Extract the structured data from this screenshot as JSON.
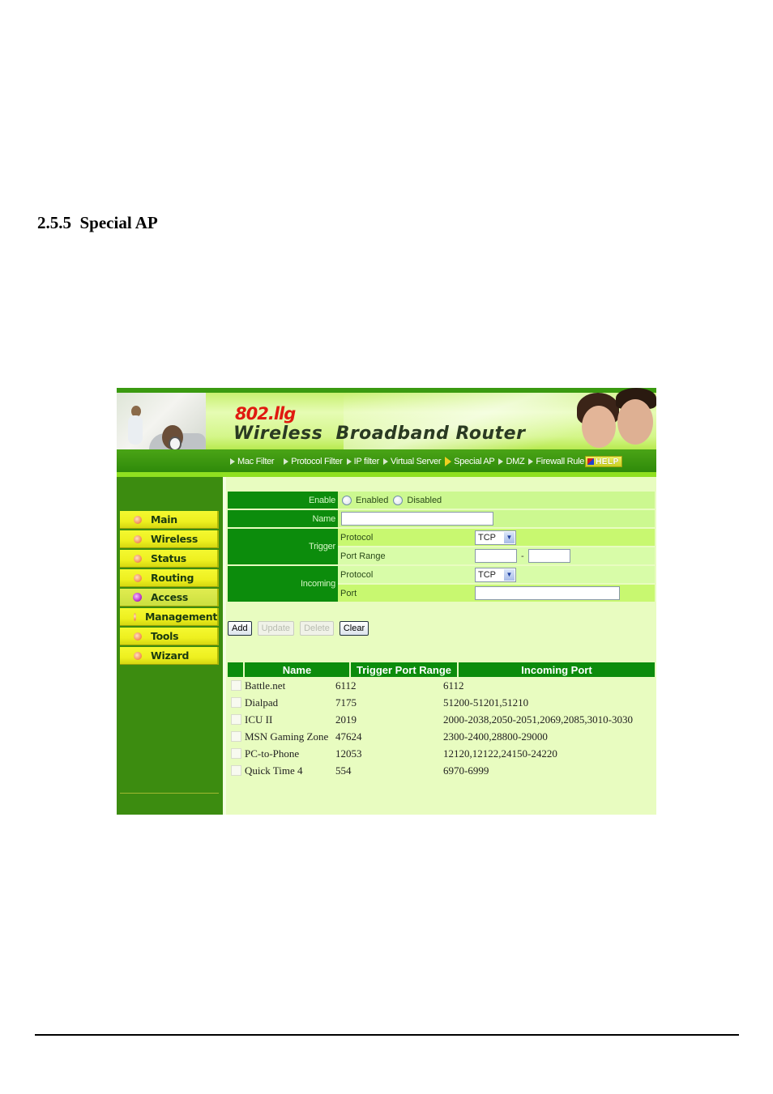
{
  "document": {
    "section_heading": "2.5.5  Special AP"
  },
  "router": {
    "brand": {
      "model": "802.llg",
      "title": "Wireless  Broadband Router"
    },
    "nav": {
      "items": [
        {
          "label": "Mac Filter",
          "active": false
        },
        {
          "label": "Protocol Filter",
          "active": false
        },
        {
          "label": "IP filter",
          "active": false
        },
        {
          "label": "Virtual Server",
          "active": false
        },
        {
          "label": "Special AP",
          "active": true
        },
        {
          "label": "DMZ",
          "active": false
        },
        {
          "label": "Firewall Rule",
          "active": false
        }
      ],
      "help_label": "HELP"
    },
    "sidebar": {
      "items": [
        {
          "label": "Main",
          "active": false
        },
        {
          "label": "Wireless",
          "active": false
        },
        {
          "label": "Status",
          "active": false
        },
        {
          "label": "Routing",
          "active": false
        },
        {
          "label": "Access",
          "active": true
        },
        {
          "label": "Management",
          "active": false
        },
        {
          "label": "Tools",
          "active": false
        },
        {
          "label": "Wizard",
          "active": false
        }
      ]
    },
    "form": {
      "enable_label": "Enable",
      "enabled_option": "Enabled",
      "disabled_option": "Disabled",
      "name_label": "Name",
      "name_value": "",
      "trigger_label": "Trigger",
      "trigger_protocol_label": "Protocol",
      "trigger_protocol_value": "TCP",
      "trigger_port_range_label": "Port Range",
      "trigger_port_start": "",
      "trigger_port_separator": "-",
      "trigger_port_end": "",
      "incoming_label": "Incoming",
      "incoming_protocol_label": "Protocol",
      "incoming_protocol_value": "TCP",
      "incoming_port_label": "Port",
      "incoming_port_value": ""
    },
    "buttons": {
      "add": "Add",
      "update": "Update",
      "delete": "Delete",
      "clear": "Clear"
    },
    "table": {
      "headers": [
        "Name",
        "Trigger Port Range",
        "Incoming Port"
      ],
      "rows": [
        {
          "name": "Battle.net",
          "trigger": "6112",
          "incoming": "6112"
        },
        {
          "name": "Dialpad",
          "trigger": "7175",
          "incoming": "51200-51201,51210"
        },
        {
          "name": "ICU II",
          "trigger": "2019",
          "incoming": "2000-2038,2050-2051,2069,2085,3010-3030"
        },
        {
          "name": "MSN Gaming Zone",
          "trigger": "47624",
          "incoming": "2300-2400,28800-29000"
        },
        {
          "name": "PC-to-Phone",
          "trigger": "12053",
          "incoming": "12120,12122,24150-24220"
        },
        {
          "name": "Quick Time 4",
          "trigger": "554",
          "incoming": "6970-6999"
        }
      ]
    }
  }
}
